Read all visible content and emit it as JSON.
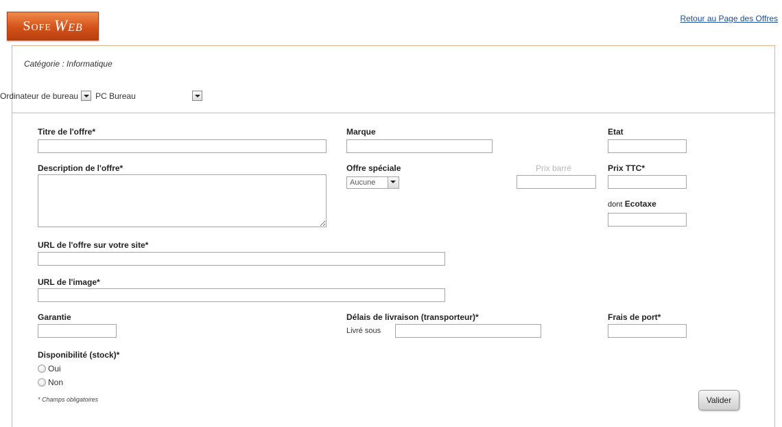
{
  "logo": {
    "part1": "Sofe",
    "part2": "Web"
  },
  "top_link": "Retour au Page des Offres",
  "category": {
    "title": "Catégorie : Informatique",
    "select1": "Ordinateur de bureau",
    "select2": "PC Bureau"
  },
  "form": {
    "titre_label": "Titre de l'offre*",
    "marque_label": "Marque",
    "etat_label": "Etat",
    "description_label": "Description de l'offre*",
    "offre_speciale_label": "Offre spéciale",
    "offre_speciale_value": "Aucune",
    "prix_barre_label": "Prix barré",
    "prix_ttc_label": "Prix TTC*",
    "ecotaxe_prefix": "dont",
    "ecotaxe_label": "Ecotaxe",
    "url_offre_label": "URL de l'offre sur votre site*",
    "url_image_label": "URL de l'image*",
    "garantie_label": "Garantie",
    "delais_label": "Délais de livraison (transporteur)*",
    "livre_sous_label": "Livré sous",
    "frais_port_label": "Frais de port*",
    "disponibilite_label": "Disponibilité (stock)*",
    "oui_label": "Oui",
    "non_label": "Non",
    "required_note": "* Champs obligatoires",
    "submit_label": "Valider"
  }
}
